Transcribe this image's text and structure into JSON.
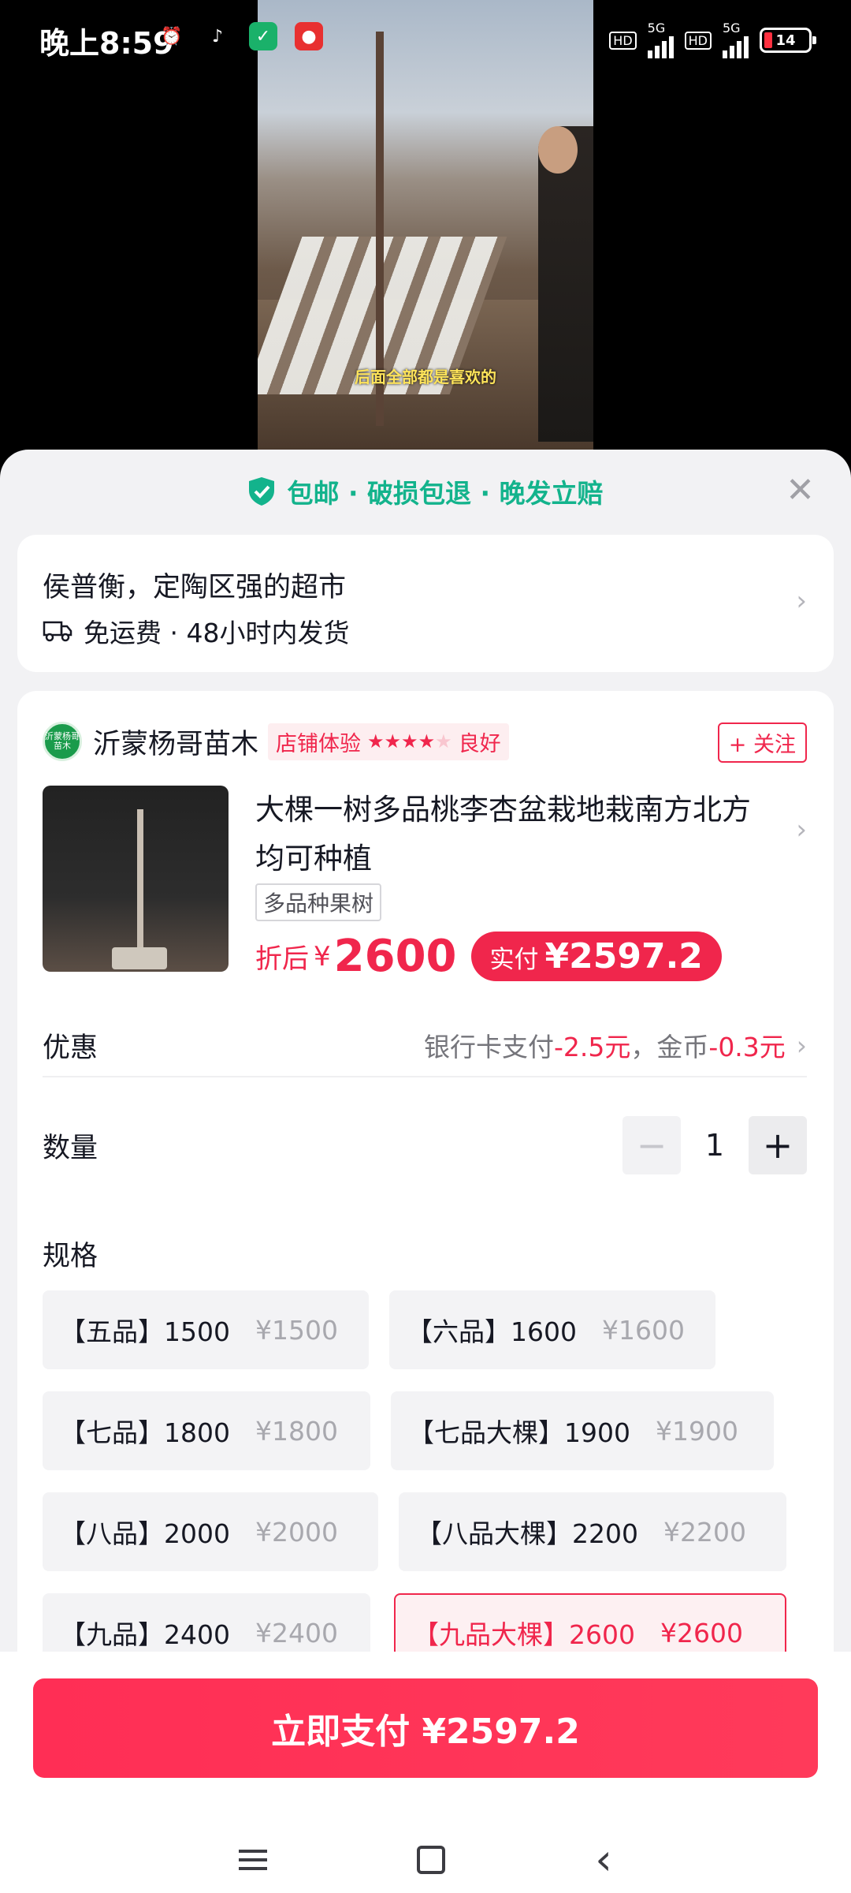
{
  "status_bar": {
    "time": "晚上8:59",
    "net1": "5G",
    "net2": "5G",
    "hd": "HD",
    "battery": "14"
  },
  "video": {
    "caption": "后面全部都是喜欢的"
  },
  "sheet": {
    "guarantee": "包邮 · 破损包退 · 晚发立赔",
    "close_icon": "close-icon"
  },
  "address": {
    "line": "侯普衡，定陶区强的超市",
    "shipping": "免运费 · 48小时内发货"
  },
  "shop": {
    "logo_text": "沂蒙杨哥苗木",
    "name": "沂蒙杨哥苗木",
    "experience_label": "店铺体验",
    "rating_stars": 4,
    "rating_text": "良好",
    "follow": "+ 关注"
  },
  "product": {
    "title": "大棵一树多品桃李杏盆栽地栽南方北方均可种植",
    "tag": "多品种果树",
    "price_prefix": "折后",
    "currency": "¥",
    "price": "2600",
    "paid_label": "实付",
    "paid_amount": "¥2597.2"
  },
  "discount": {
    "label": "优惠",
    "bank_text": "银行卡支付",
    "bank_value": "-2.5元",
    "separator": "，",
    "coin_text": "金币",
    "coin_value": "-0.3元"
  },
  "quantity": {
    "label": "数量",
    "value": "1",
    "minus": "−",
    "plus": "+"
  },
  "spec": {
    "label": "规格",
    "options": [
      {
        "name": "【五品】1500",
        "price": "¥1500"
      },
      {
        "name": "【六品】1600",
        "price": "¥1600"
      },
      {
        "name": "【七品】1800",
        "price": "¥1800"
      },
      {
        "name": "【七品大棵】1900",
        "price": "¥1900"
      },
      {
        "name": "【八品】2000",
        "price": "¥2000"
      },
      {
        "name": "【八品大棵】2200",
        "price": "¥2200"
      },
      {
        "name": "【九品】2400",
        "price": "¥2400"
      },
      {
        "name": "【九品大棵】2600",
        "price": "¥2600",
        "selected": true
      }
    ]
  },
  "pay_button": "立即支付 ¥2597.2",
  "colors": {
    "accent": "#f0264c",
    "guarantee": "#13b38c"
  }
}
